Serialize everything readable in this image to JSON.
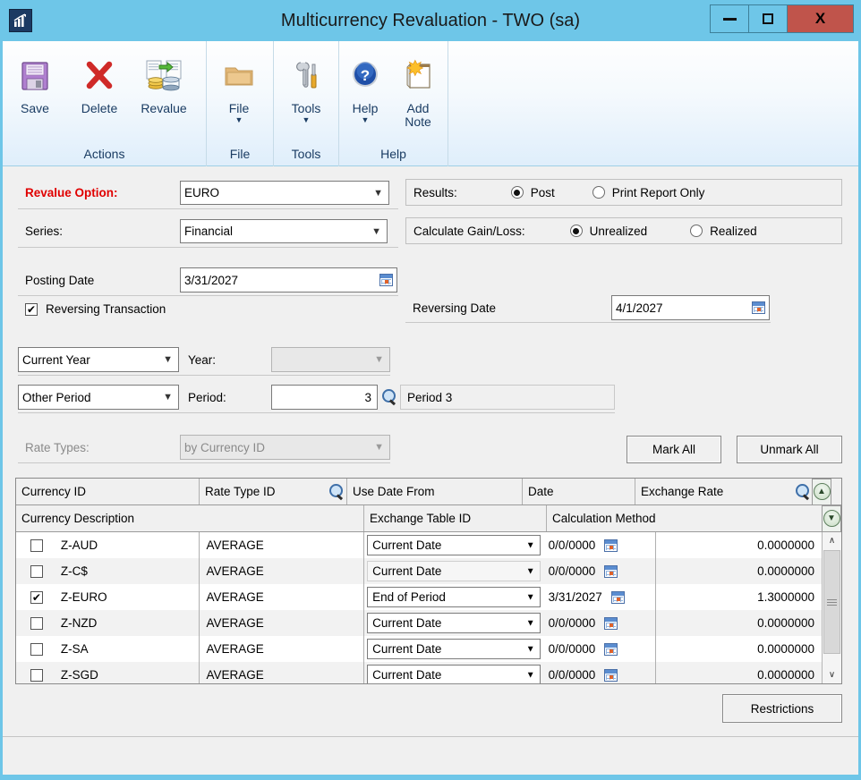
{
  "window": {
    "title": "Multicurrency Revaluation  -  TWO (sa)",
    "app_icon": "chart-icon",
    "minimize_label": "–",
    "maximize_label": "□",
    "close_label": "X",
    "titlebar_color": "#6ec6e8",
    "close_color": "#c0544b"
  },
  "ribbon": {
    "groups": [
      {
        "label": "Actions",
        "items": [
          {
            "label": "Save",
            "icon": "save-floppy-icon",
            "caret": false
          },
          {
            "label": "Delete",
            "icon": "delete-x-icon",
            "caret": false
          },
          {
            "label": "Revalue",
            "icon": "revalue-coins-icon",
            "caret": false
          }
        ]
      },
      {
        "label": "File",
        "items": [
          {
            "label": "File",
            "icon": "folder-icon",
            "caret": true,
            "caret_glyph": "▼"
          }
        ]
      },
      {
        "label": "Tools",
        "items": [
          {
            "label": "Tools",
            "icon": "wrench-screwdriver-icon",
            "caret": true,
            "caret_glyph": "▼"
          }
        ]
      },
      {
        "label": "Help",
        "items": [
          {
            "label": "Help",
            "icon": "help-question-icon",
            "caret": true,
            "caret_glyph": "▼"
          },
          {
            "label": "Add\nNote",
            "label_line1": "Add",
            "label_line2": "Note",
            "icon": "add-note-icon",
            "caret": false
          }
        ]
      }
    ]
  },
  "form": {
    "revalue_option_label": "Revalue Option:",
    "revalue_option_value": "EURO",
    "series_label": "Series:",
    "series_value": "Financial",
    "posting_date_label": "Posting Date",
    "posting_date_value": "3/31/2027",
    "reversing_transaction_label": "Reversing Transaction",
    "reversing_transaction_checked": true,
    "reversing_date_label": "Reversing Date",
    "reversing_date_value": "4/1/2027",
    "results_label": "Results:",
    "results_options": [
      "Post",
      "Print Report Only"
    ],
    "results_selected": "Post",
    "gainloss_label": "Calculate Gain/Loss:",
    "gainloss_options": [
      "Unrealized",
      "Realized"
    ],
    "gainloss_selected": "Unrealized",
    "year_mode_value": "Current Year",
    "year_label": "Year:",
    "year_value": "",
    "year_disabled": true,
    "period_mode_value": "Other Period",
    "period_label": "Period:",
    "period_number": "3",
    "period_description": "Period 3",
    "rate_types_label": "Rate Types:",
    "rate_types_value": "by Currency ID",
    "rate_types_disabled": true,
    "mark_all_label": "Mark All",
    "unmark_all_label": "Unmark All",
    "restrictions_label": "Restrictions"
  },
  "grid": {
    "headers_row1": [
      "Currency ID",
      "Rate Type ID",
      "Use Date From",
      "Date",
      "Exchange Rate"
    ],
    "headers_row2": [
      "Currency Description",
      "Exchange Table ID",
      "Calculation Method"
    ],
    "rows": [
      {
        "marked": false,
        "currency_id": "Z-AUD",
        "rate_type_id": "AVERAGE",
        "use_date_from": "Current Date",
        "date": "0/0/0000",
        "exchange_rate": "0.0000000"
      },
      {
        "marked": false,
        "currency_id": "Z-C$",
        "rate_type_id": "AVERAGE",
        "use_date_from": "Current Date",
        "date": "0/0/0000",
        "exchange_rate": "0.0000000"
      },
      {
        "marked": true,
        "currency_id": "Z-EURO",
        "rate_type_id": "AVERAGE",
        "use_date_from": "End of Period",
        "date": "3/31/2027",
        "exchange_rate": "1.3000000"
      },
      {
        "marked": false,
        "currency_id": "Z-NZD",
        "rate_type_id": "AVERAGE",
        "use_date_from": "Current Date",
        "date": "0/0/0000",
        "exchange_rate": "0.0000000"
      },
      {
        "marked": false,
        "currency_id": "Z-SA",
        "rate_type_id": "AVERAGE",
        "use_date_from": "Current Date",
        "date": "0/0/0000",
        "exchange_rate": "0.0000000"
      },
      {
        "marked": false,
        "currency_id": "Z-SGD",
        "rate_type_id": "AVERAGE",
        "use_date_from": "Current Date",
        "date": "0/0/0000",
        "exchange_rate": "0.0000000"
      }
    ],
    "scroll_up_glyph": "∧",
    "scroll_down_glyph": "∨",
    "expand_up_glyph": "«",
    "expand_down_glyph": "»"
  }
}
